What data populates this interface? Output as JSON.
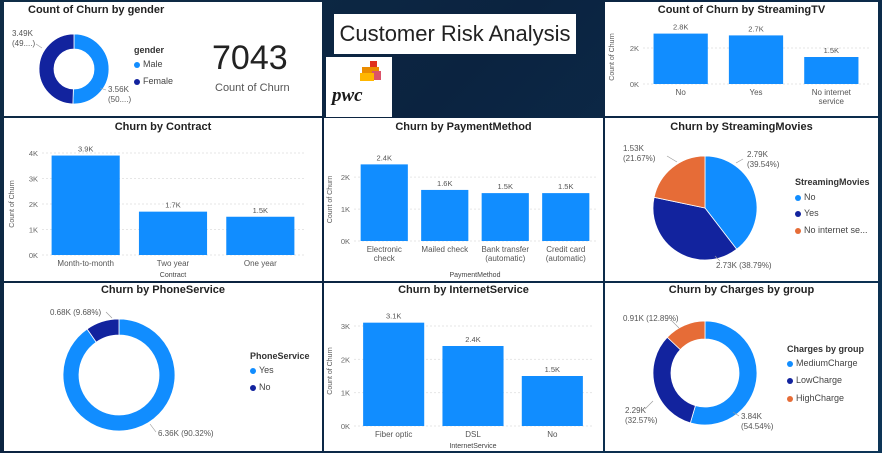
{
  "banner": {
    "title": "Customer Risk Analysis"
  },
  "logo": {
    "text": "pwc"
  },
  "kpi": {
    "value": "7043",
    "label": "Count of Churn"
  },
  "gender_chart": {
    "title": "Count of Churn by gender",
    "legend_title": "gender",
    "legend": [
      {
        "label": "Male",
        "color": "#118DFF"
      },
      {
        "label": "Female",
        "color": "#12239E"
      }
    ],
    "labels": {
      "female": "3.49K",
      "female_pct": "(49....)",
      "male": "3.56K",
      "male_pct": "(50....)"
    }
  },
  "chart_data": [
    {
      "id": "gender",
      "type": "pie",
      "title": "Count of Churn by gender",
      "categories": [
        "Male",
        "Female"
      ],
      "values": [
        3560,
        3490
      ],
      "colors": [
        "#118DFF",
        "#12239E"
      ]
    },
    {
      "id": "streamingtv",
      "type": "bar",
      "title": "Count of Churn by StreamingTV",
      "categories": [
        "No",
        "Yes",
        "No internet service"
      ],
      "cat_lines": [
        [
          "No"
        ],
        [
          "Yes"
        ],
        [
          "No internet",
          "service"
        ]
      ],
      "values": [
        2800,
        2700,
        1500
      ],
      "data_labels": [
        "2.8K",
        "2.7K",
        "1.5K"
      ],
      "ylabel": "Count of Churn",
      "xlabel": "",
      "yticks": [
        0,
        2000
      ],
      "ytick_labels": [
        "0K",
        "2K"
      ],
      "ylim": [
        0,
        3000
      ],
      "color": "#118DFF"
    },
    {
      "id": "contract",
      "type": "bar",
      "title": "Churn by Contract",
      "categories": [
        "Month-to-month",
        "Two year",
        "One year"
      ],
      "cat_lines": [
        [
          "Month-to-month"
        ],
        [
          "Two year"
        ],
        [
          "One year"
        ]
      ],
      "values": [
        3900,
        1700,
        1500
      ],
      "data_labels": [
        "3.9K",
        "1.7K",
        "1.5K"
      ],
      "ylabel": "Count of Churn",
      "xlabel": "Contract",
      "yticks": [
        0,
        1000,
        2000,
        3000,
        4000
      ],
      "ytick_labels": [
        "0K",
        "1K",
        "2K",
        "3K",
        "4K"
      ],
      "ylim": [
        0,
        4000
      ],
      "color": "#118DFF"
    },
    {
      "id": "payment",
      "type": "bar",
      "title": "Churn by PaymentMethod",
      "categories": [
        "Electronic check",
        "Mailed check",
        "Bank transfer (automatic)",
        "Credit card (automatic)"
      ],
      "cat_lines": [
        [
          "Electronic",
          "check"
        ],
        [
          "Mailed check"
        ],
        [
          "Bank transfer",
          "(automatic)"
        ],
        [
          "Credit card",
          "(automatic)"
        ]
      ],
      "values": [
        2400,
        1600,
        1500,
        1500
      ],
      "data_labels": [
        "2.4K",
        "1.6K",
        "1.5K",
        "1.5K"
      ],
      "ylabel": "Count of Churn",
      "xlabel": "PaymentMethod",
      "yticks": [
        0,
        1000,
        2000
      ],
      "ytick_labels": [
        "0K",
        "1K",
        "2K"
      ],
      "ylim": [
        0,
        2600
      ],
      "color": "#118DFF"
    },
    {
      "id": "movies",
      "type": "pie",
      "title": "Churn by StreamingMovies",
      "categories": [
        "No",
        "Yes",
        "No internet se..."
      ],
      "values": [
        2790,
        2730,
        1530
      ],
      "percents": [
        "39.54%",
        "38.79%",
        "21.67%"
      ],
      "colors": [
        "#118DFF",
        "#12239E",
        "#E66C37"
      ]
    },
    {
      "id": "phone",
      "type": "pie",
      "title": "Churn by PhoneService",
      "categories": [
        "Yes",
        "No"
      ],
      "values": [
        6360,
        680
      ],
      "percents": [
        "90.32%",
        "9.68%"
      ],
      "colors": [
        "#118DFF",
        "#12239E"
      ]
    },
    {
      "id": "internet",
      "type": "bar",
      "title": "Churn by InternetService",
      "categories": [
        "Fiber optic",
        "DSL",
        "No"
      ],
      "cat_lines": [
        [
          "Fiber optic"
        ],
        [
          "DSL"
        ],
        [
          "No"
        ]
      ],
      "values": [
        3100,
        2400,
        1500
      ],
      "data_labels": [
        "3.1K",
        "2.4K",
        "1.5K"
      ],
      "ylabel": "Count of Churn",
      "xlabel": "InternetService",
      "yticks": [
        0,
        1000,
        2000,
        3000
      ],
      "ytick_labels": [
        "0K",
        "1K",
        "2K",
        "3K"
      ],
      "ylim": [
        0,
        3300
      ],
      "color": "#118DFF"
    },
    {
      "id": "charges",
      "type": "pie",
      "title": "Churn by Charges by group",
      "categories": [
        "MediumCharge",
        "LowCharge",
        "HighCharge"
      ],
      "values": [
        3840,
        2290,
        910
      ],
      "percents": [
        "54.54%",
        "32.57%",
        "12.89%"
      ],
      "colors": [
        "#118DFF",
        "#12239E",
        "#E66C37"
      ]
    }
  ],
  "movies_chart": {
    "legend_title": "StreamingMovies",
    "legend": [
      {
        "label": "No",
        "color": "#118DFF"
      },
      {
        "label": "Yes",
        "color": "#12239E"
      },
      {
        "label": "No internet se...",
        "color": "#E66C37"
      }
    ],
    "labels": {
      "no": "2.79K",
      "no_pct": "(39.54%)",
      "yes": "2.73K (38.79%)",
      "nis": "1.53K",
      "nis_pct": "(21.67%)"
    }
  },
  "phone_chart": {
    "legend_title": "PhoneService",
    "legend": [
      {
        "label": "Yes",
        "color": "#118DFF"
      },
      {
        "label": "No",
        "color": "#12239E"
      }
    ],
    "labels": {
      "no": "0.68K (9.68%)",
      "yes": "6.36K (90.32%)"
    }
  },
  "charges_chart": {
    "legend_title": "Charges by group",
    "legend": [
      {
        "label": "MediumCharge",
        "color": "#118DFF"
      },
      {
        "label": "LowCharge",
        "color": "#12239E"
      },
      {
        "label": "HighCharge",
        "color": "#E66C37"
      }
    ],
    "labels": {
      "high": "0.91K (12.89%)",
      "low": "2.29K",
      "low_pct": "(32.57%)",
      "med": "3.84K",
      "med_pct": "(54.54%)"
    }
  }
}
